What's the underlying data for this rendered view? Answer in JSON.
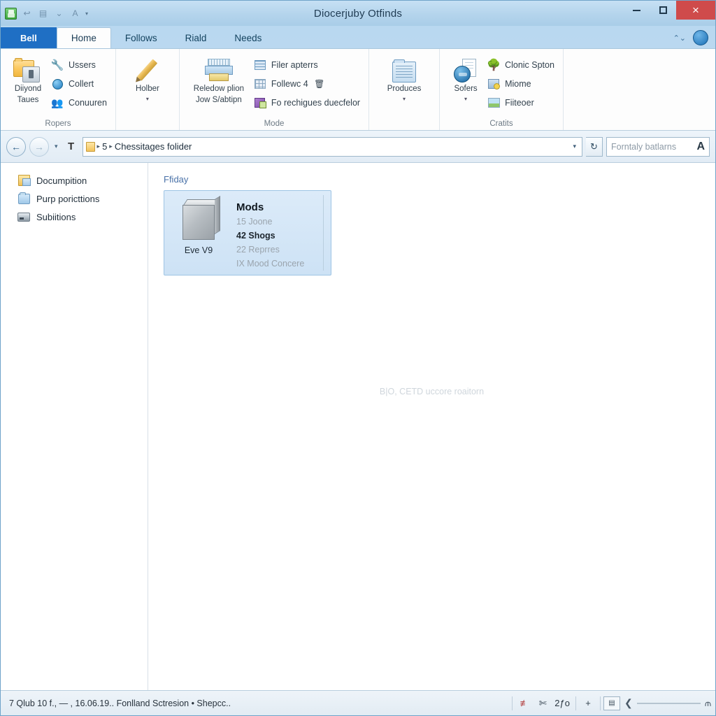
{
  "window": {
    "title": "Diocerjuby Otfinds",
    "minimize_label": "–",
    "maximize_label": "□",
    "close_label": "×"
  },
  "quick_access": {
    "app_icon": "app-save-icon",
    "items": [
      {
        "name": "undo-icon",
        "glyph": "↩"
      },
      {
        "name": "save-icon",
        "glyph": "▤"
      },
      {
        "name": "dropdown-icon",
        "glyph": "⌄"
      },
      {
        "name": "font-icon",
        "glyph": "A"
      },
      {
        "name": "customize-caret-icon",
        "glyph": "▾"
      }
    ]
  },
  "tabs": {
    "file_tab": "Bell",
    "items": [
      {
        "label": "Home",
        "active": true
      },
      {
        "label": "Follows",
        "active": false
      },
      {
        "label": "Riald",
        "active": false
      },
      {
        "label": "Needs",
        "active": false
      }
    ],
    "collapse_icon": "chevron-collapse-icon",
    "collapse_glyph": "⌃⌄",
    "help_glyph": "?"
  },
  "ribbon": {
    "groups": [
      {
        "label": "Ropers",
        "big_buttons": [
          {
            "label_line1": "Diiyond",
            "label_line2": "Taues",
            "icon": "pin-folder-icon"
          }
        ],
        "small_buttons": [
          {
            "label": "Ussers",
            "icon": "wrench-icon"
          },
          {
            "label": "Collert",
            "icon": "globe-icon"
          },
          {
            "label": "Conuuren",
            "icon": "people-icon"
          }
        ]
      },
      {
        "label": "",
        "big_buttons": [
          {
            "label_line1": "Holber",
            "label_line2": "",
            "icon": "pencil-icon",
            "caret": "▾"
          }
        ],
        "small_buttons": []
      },
      {
        "label": "Mode",
        "big_buttons": [
          {
            "label_line1": "Reledow plion",
            "label_line2": "Jow S/abtipn",
            "icon": "printer-folder-icon"
          }
        ],
        "small_buttons": [
          {
            "label": "Filer apterrs",
            "icon": "grid-lines-icon"
          },
          {
            "label": "Follewc 4",
            "icon": "grid-dots-icon",
            "trailing_icon": "trash-icon",
            "trailing_glyph": "🗑"
          },
          {
            "label": "Fo rechigues duecfelor",
            "icon": "purple-block-icon"
          }
        ]
      },
      {
        "label": "",
        "big_buttons": [
          {
            "label_line1": "Produces",
            "label_line2": "",
            "icon": "document-folder-icon",
            "caret": "▾"
          }
        ],
        "small_buttons": []
      },
      {
        "label": "Cratits",
        "big_buttons": [
          {
            "label_line1": "Sofers",
            "label_line2": "",
            "icon": "share-globe-icon",
            "caret": "▾"
          }
        ],
        "small_buttons": [
          {
            "label": "Clonic Spton",
            "icon": "tree-icon"
          },
          {
            "label": "Miome",
            "icon": "share-user-icon"
          },
          {
            "label": "Fiiteoer",
            "icon": "picture-icon"
          }
        ]
      }
    ]
  },
  "address_bar": {
    "back_glyph": "←",
    "forward_glyph": "→",
    "history_caret": "▾",
    "up_glyph": "T",
    "crumbs": [
      {
        "label": "5"
      },
      {
        "label": "Chessitages folider"
      }
    ],
    "crumb_separator": "▸",
    "dropdown_glyph": "▾",
    "refresh_glyph": "↻",
    "search_placeholder": "Forntaly batlarns",
    "search_value": "",
    "search_glyph": "A"
  },
  "sidebar": {
    "items": [
      {
        "label": "Documpition",
        "icon": "document-folder-icon"
      },
      {
        "label": "Purp poricttions",
        "icon": "blue-folder-icon"
      },
      {
        "label": "Subiitions",
        "icon": "drive-icon"
      }
    ]
  },
  "content": {
    "group_header": "Ffiday",
    "watermark": "B|O, CETD uccore roaitorn",
    "items": [
      {
        "thumb_caption": "Eve V9",
        "icon": "cube-box-icon",
        "details": [
          {
            "text": "Mods",
            "style": "title"
          },
          {
            "text": "15 Joone",
            "style": "grey"
          },
          {
            "text": "42 Shogs",
            "style": "bold"
          },
          {
            "text": "22 Reprres",
            "style": "grey"
          },
          {
            "text": "IX Mood Concere",
            "style": "grey"
          }
        ]
      }
    ]
  },
  "status_bar": {
    "text": "7 Qlub 10 f., — , 16.06.19.. Fonlland Sctresion • Shepcc..",
    "icons": [
      {
        "name": "filter-red-icon",
        "glyph": "≢",
        "red": true
      },
      {
        "name": "scissors-icon",
        "glyph": "✄",
        "red": false
      }
    ],
    "count": "2ƒo",
    "plus_glyph": "+",
    "view-box": "▤",
    "slider_left_glyph": "❮",
    "slider_knob_glyph": "⫙"
  },
  "colors": {
    "accent_blue": "#1f6fc4",
    "title_gradient_top": "#c6e0f4",
    "title_gradient_bottom": "#a9cde8",
    "close_red": "#cf4b4b",
    "tile_selected": "#cde2f5",
    "group_header_blue": "#4a72a8",
    "watermark_grey": "#cfd6dc"
  }
}
